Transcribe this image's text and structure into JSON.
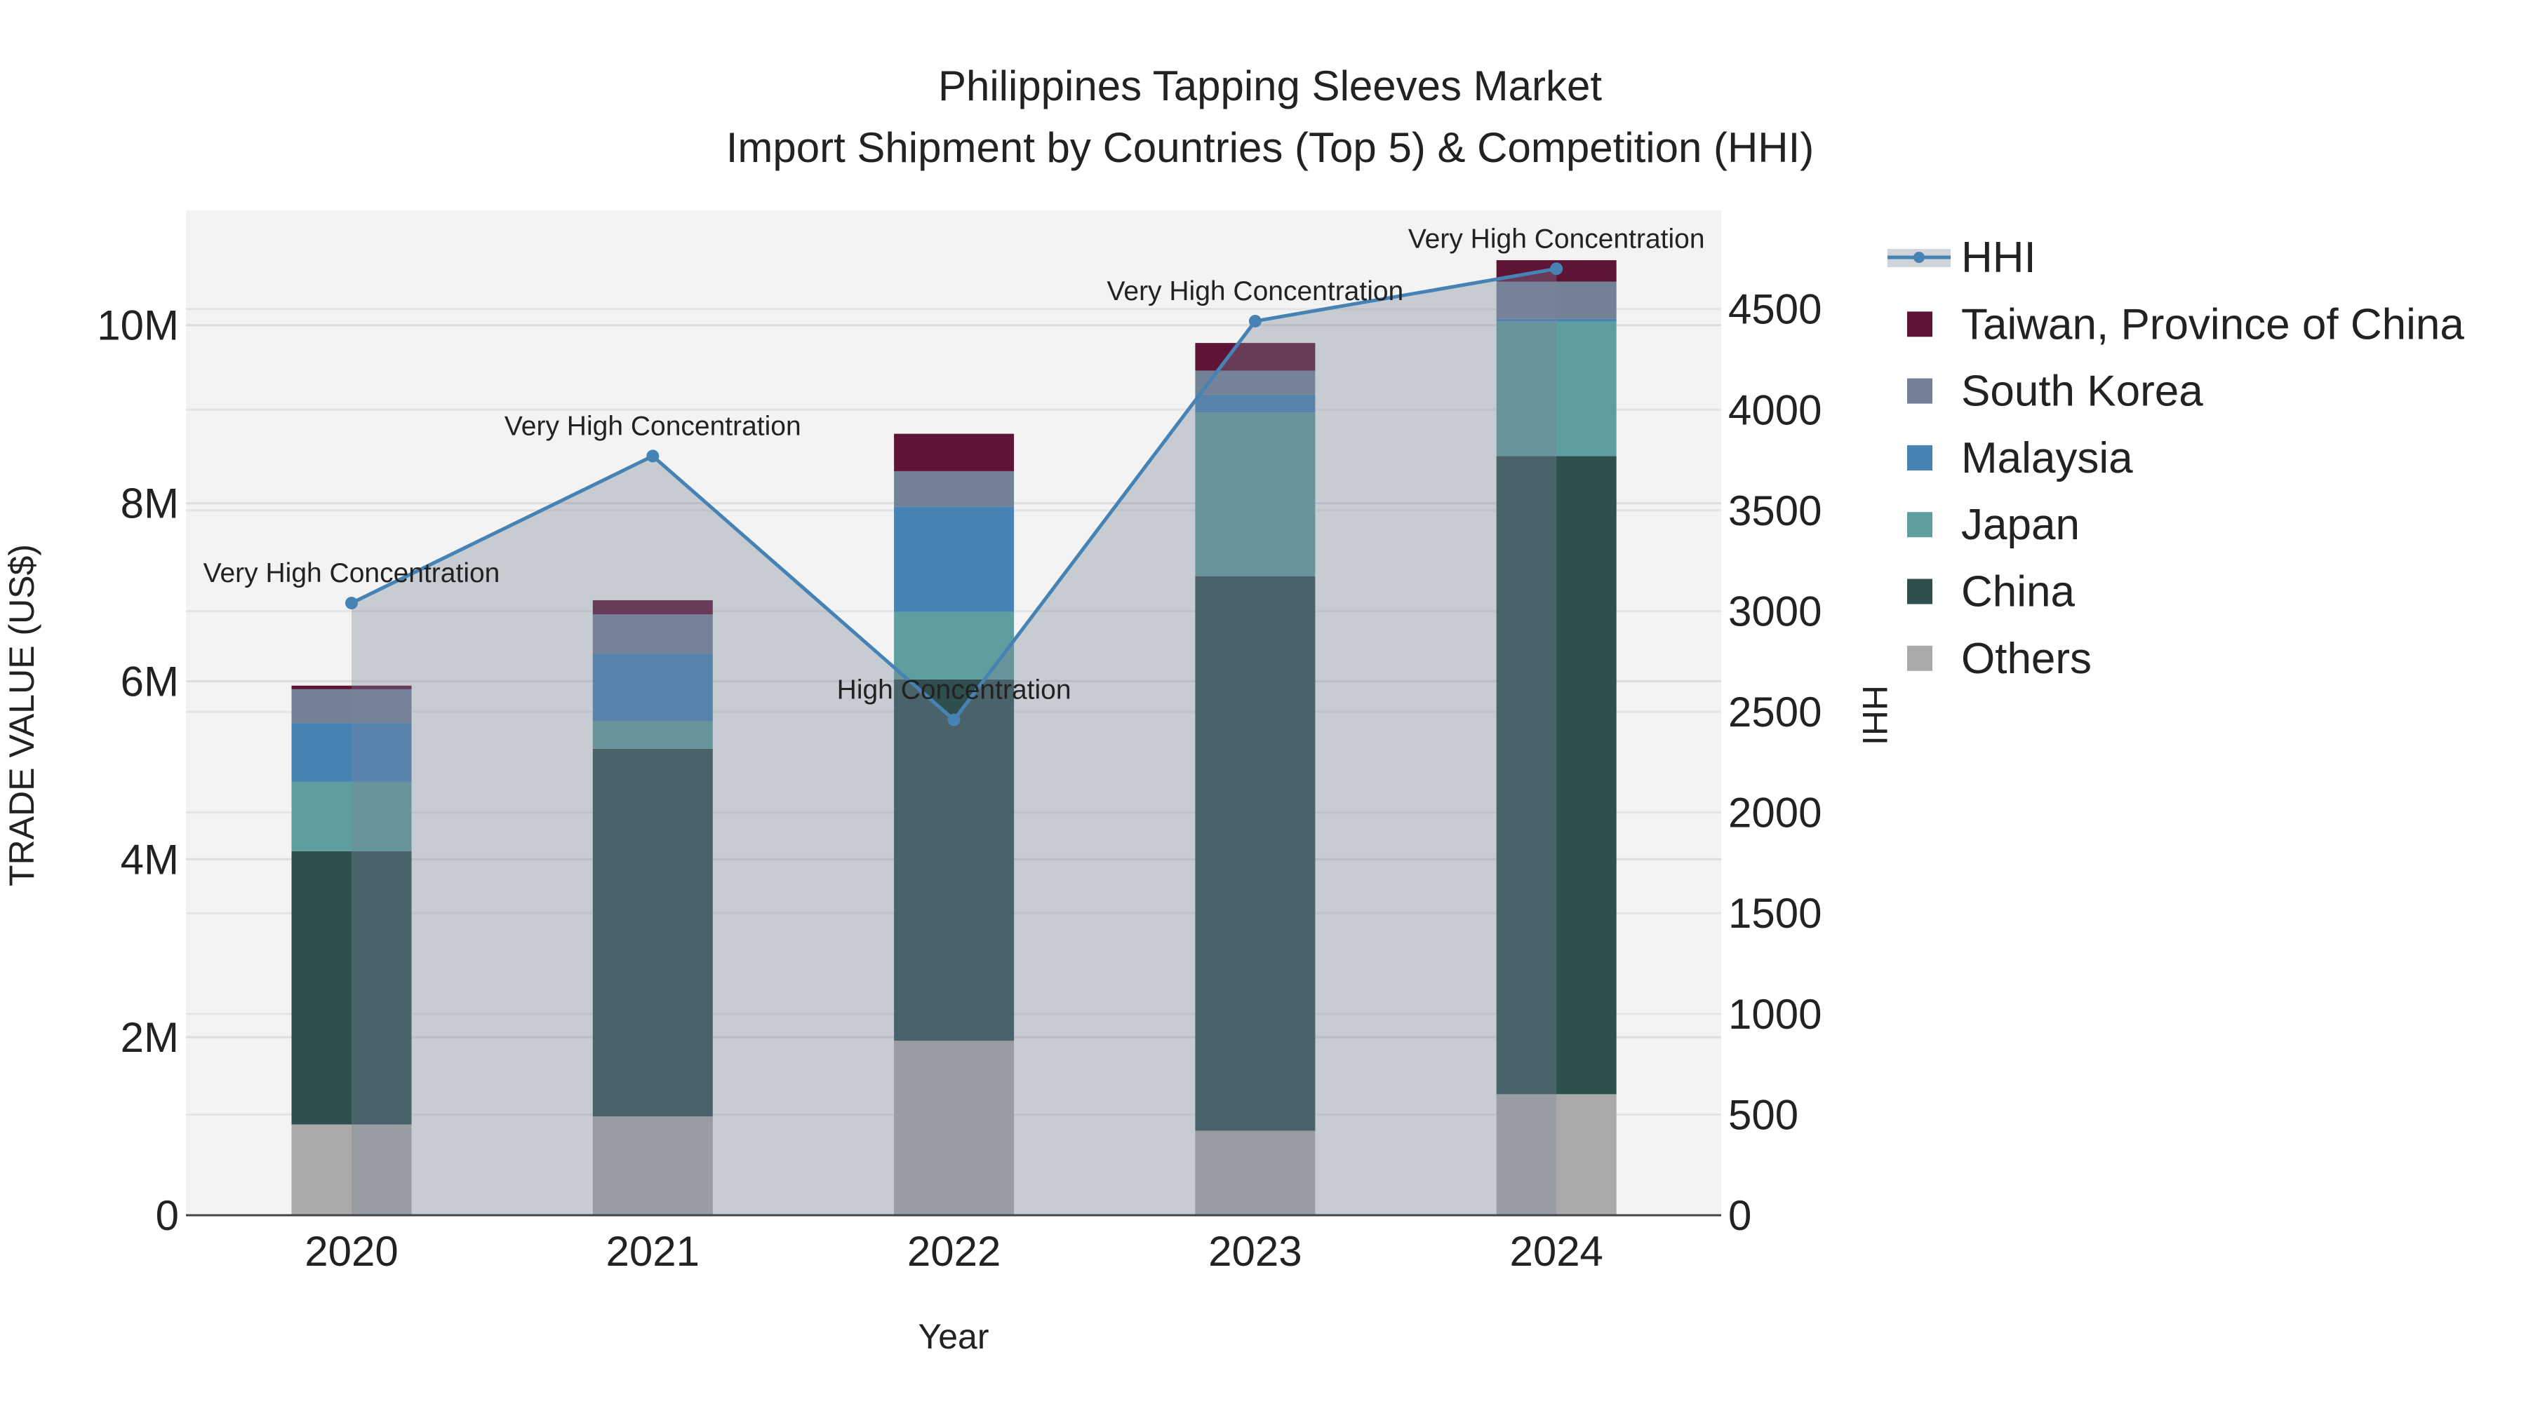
{
  "chart_data": {
    "type": "bar",
    "title": "Philippines Tapping Sleeves Market",
    "subtitle": "Import Shipment by Countries (Top 5) & Competition (HHI)",
    "xlabel": "Year",
    "ylabel": "TRADE VALUE (US$)",
    "y2label": "HHI",
    "categories": [
      "2020",
      "2021",
      "2022",
      "2023",
      "2024"
    ],
    "ylim": [
      0,
      11290000
    ],
    "y2lim": [
      0,
      4990
    ],
    "yticks": [
      0,
      2000000,
      4000000,
      6000000,
      8000000,
      10000000
    ],
    "ytick_labels": [
      "0",
      "2M",
      "4M",
      "6M",
      "8M",
      "10M"
    ],
    "y2ticks": [
      0,
      500,
      1000,
      1500,
      2000,
      2500,
      3000,
      3500,
      4000,
      4500
    ],
    "y2tick_labels": [
      "0",
      "500",
      "1000",
      "1500",
      "2000",
      "2500",
      "3000",
      "3500",
      "4000",
      "4500"
    ],
    "grid": true,
    "legend_placement": "right",
    "series": [
      {
        "name": "Others",
        "color": "#aaaaaa",
        "values": [
          1020000,
          1110000,
          1960000,
          950000,
          1360000
        ]
      },
      {
        "name": "China",
        "color": "#2f4f4f",
        "values": [
          3070000,
          4130000,
          4060000,
          6230000,
          7170000
        ]
      },
      {
        "name": "Japan",
        "color": "#5f9e9e",
        "values": [
          780000,
          310000,
          760000,
          1840000,
          1510000
        ]
      },
      {
        "name": "Malaysia",
        "color": "#4682b4",
        "values": [
          660000,
          760000,
          1180000,
          200000,
          30000
        ]
      },
      {
        "name": "South Korea",
        "color": "#738196",
        "values": [
          380000,
          440000,
          400000,
          270000,
          420000
        ]
      },
      {
        "name": "Taiwan, Province of China",
        "color": "#5e1434",
        "values": [
          40000,
          160000,
          420000,
          310000,
          240000
        ]
      }
    ],
    "hhi": {
      "name": "HHI",
      "color": "#4682b4",
      "values": [
        3040,
        3770,
        2460,
        4440,
        4700
      ],
      "annotations": [
        "Very High Concentration",
        "Very High Concentration",
        "High Concentration",
        "Very High Concentration",
        "Very High Concentration"
      ]
    },
    "legend": [
      "HHI",
      "Taiwan, Province of China",
      "South Korea",
      "Malaysia",
      "Japan",
      "China",
      "Others"
    ]
  }
}
